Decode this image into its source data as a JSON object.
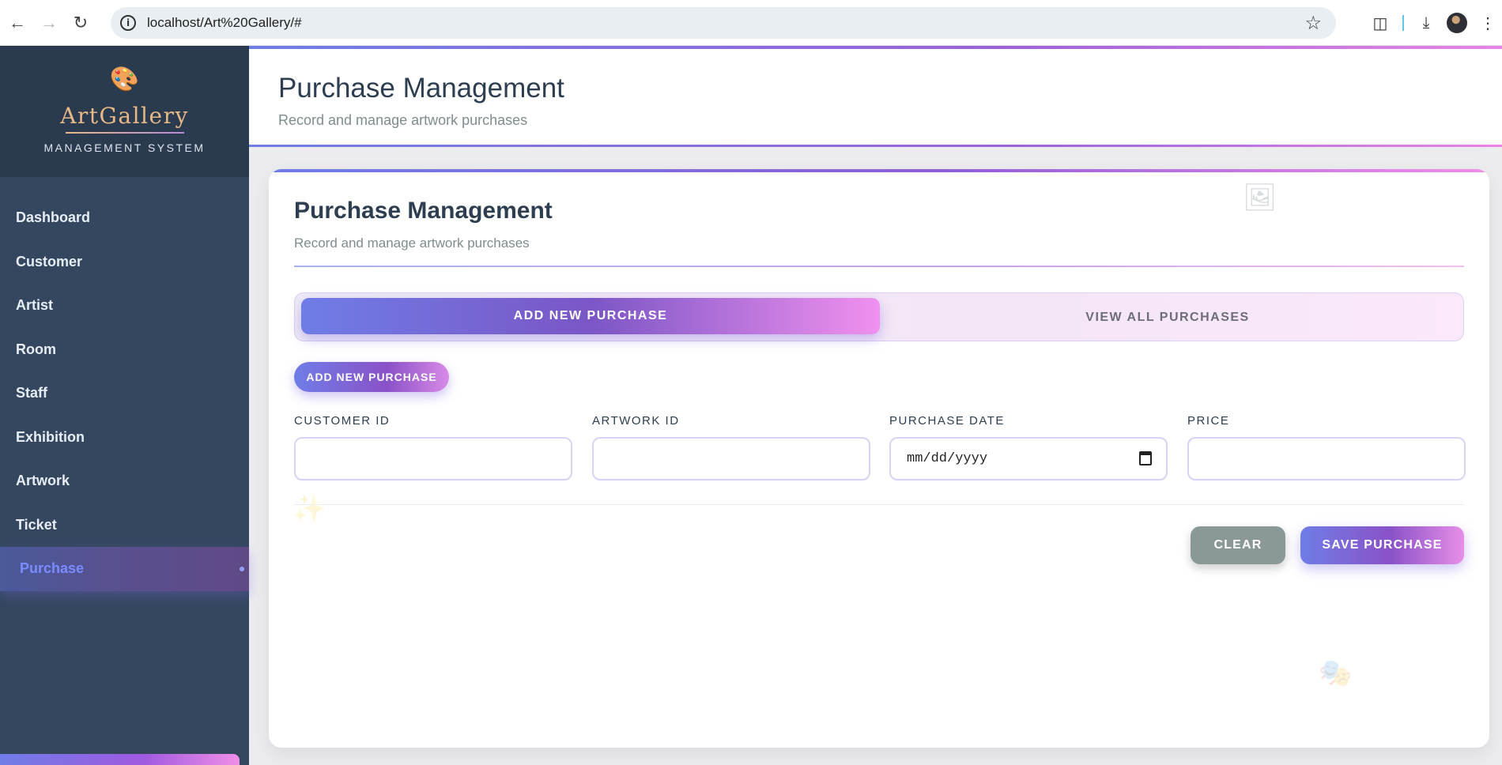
{
  "browser": {
    "url": "localhost/Art%20Gallery/#"
  },
  "sidebar": {
    "brand_title": "ArtGallery",
    "brand_subtitle": "MANAGEMENT SYSTEM",
    "items": [
      {
        "label": "Dashboard"
      },
      {
        "label": "Customer"
      },
      {
        "label": "Artist"
      },
      {
        "label": "Room"
      },
      {
        "label": "Staff"
      },
      {
        "label": "Exhibition"
      },
      {
        "label": "Artwork"
      },
      {
        "label": "Ticket"
      },
      {
        "label": "Purchase",
        "active": true
      }
    ]
  },
  "header": {
    "title": "Purchase Management",
    "subtitle": "Record and manage artwork purchases"
  },
  "card": {
    "title": "Purchase Management",
    "subtitle": "Record and manage artwork purchases",
    "tabs": [
      {
        "label": "ADD NEW PURCHASE",
        "active": true
      },
      {
        "label": "VIEW ALL PURCHASES",
        "active": false
      }
    ],
    "section_button": "ADD NEW PURCHASE",
    "fields": {
      "customer_id": {
        "label": "CUSTOMER ID",
        "value": ""
      },
      "artwork_id": {
        "label": "ARTWORK ID",
        "value": ""
      },
      "purchase_date": {
        "label": "PURCHASE DATE",
        "placeholder": "mm/dd/yyyy"
      },
      "price": {
        "label": "PRICE",
        "value": ""
      }
    },
    "actions": {
      "clear": "CLEAR",
      "save": "SAVE PURCHASE"
    }
  },
  "colors": {
    "accent_start": "#6f7de6",
    "accent_end": "#f08ee8",
    "sidebar_bg": "#34475f",
    "active_menu_text": "#7a8cff"
  },
  "icons": {
    "brand": "palette-icon",
    "decorations": [
      "picture-icon",
      "sparkles-icon",
      "theater-masks-icon"
    ]
  }
}
